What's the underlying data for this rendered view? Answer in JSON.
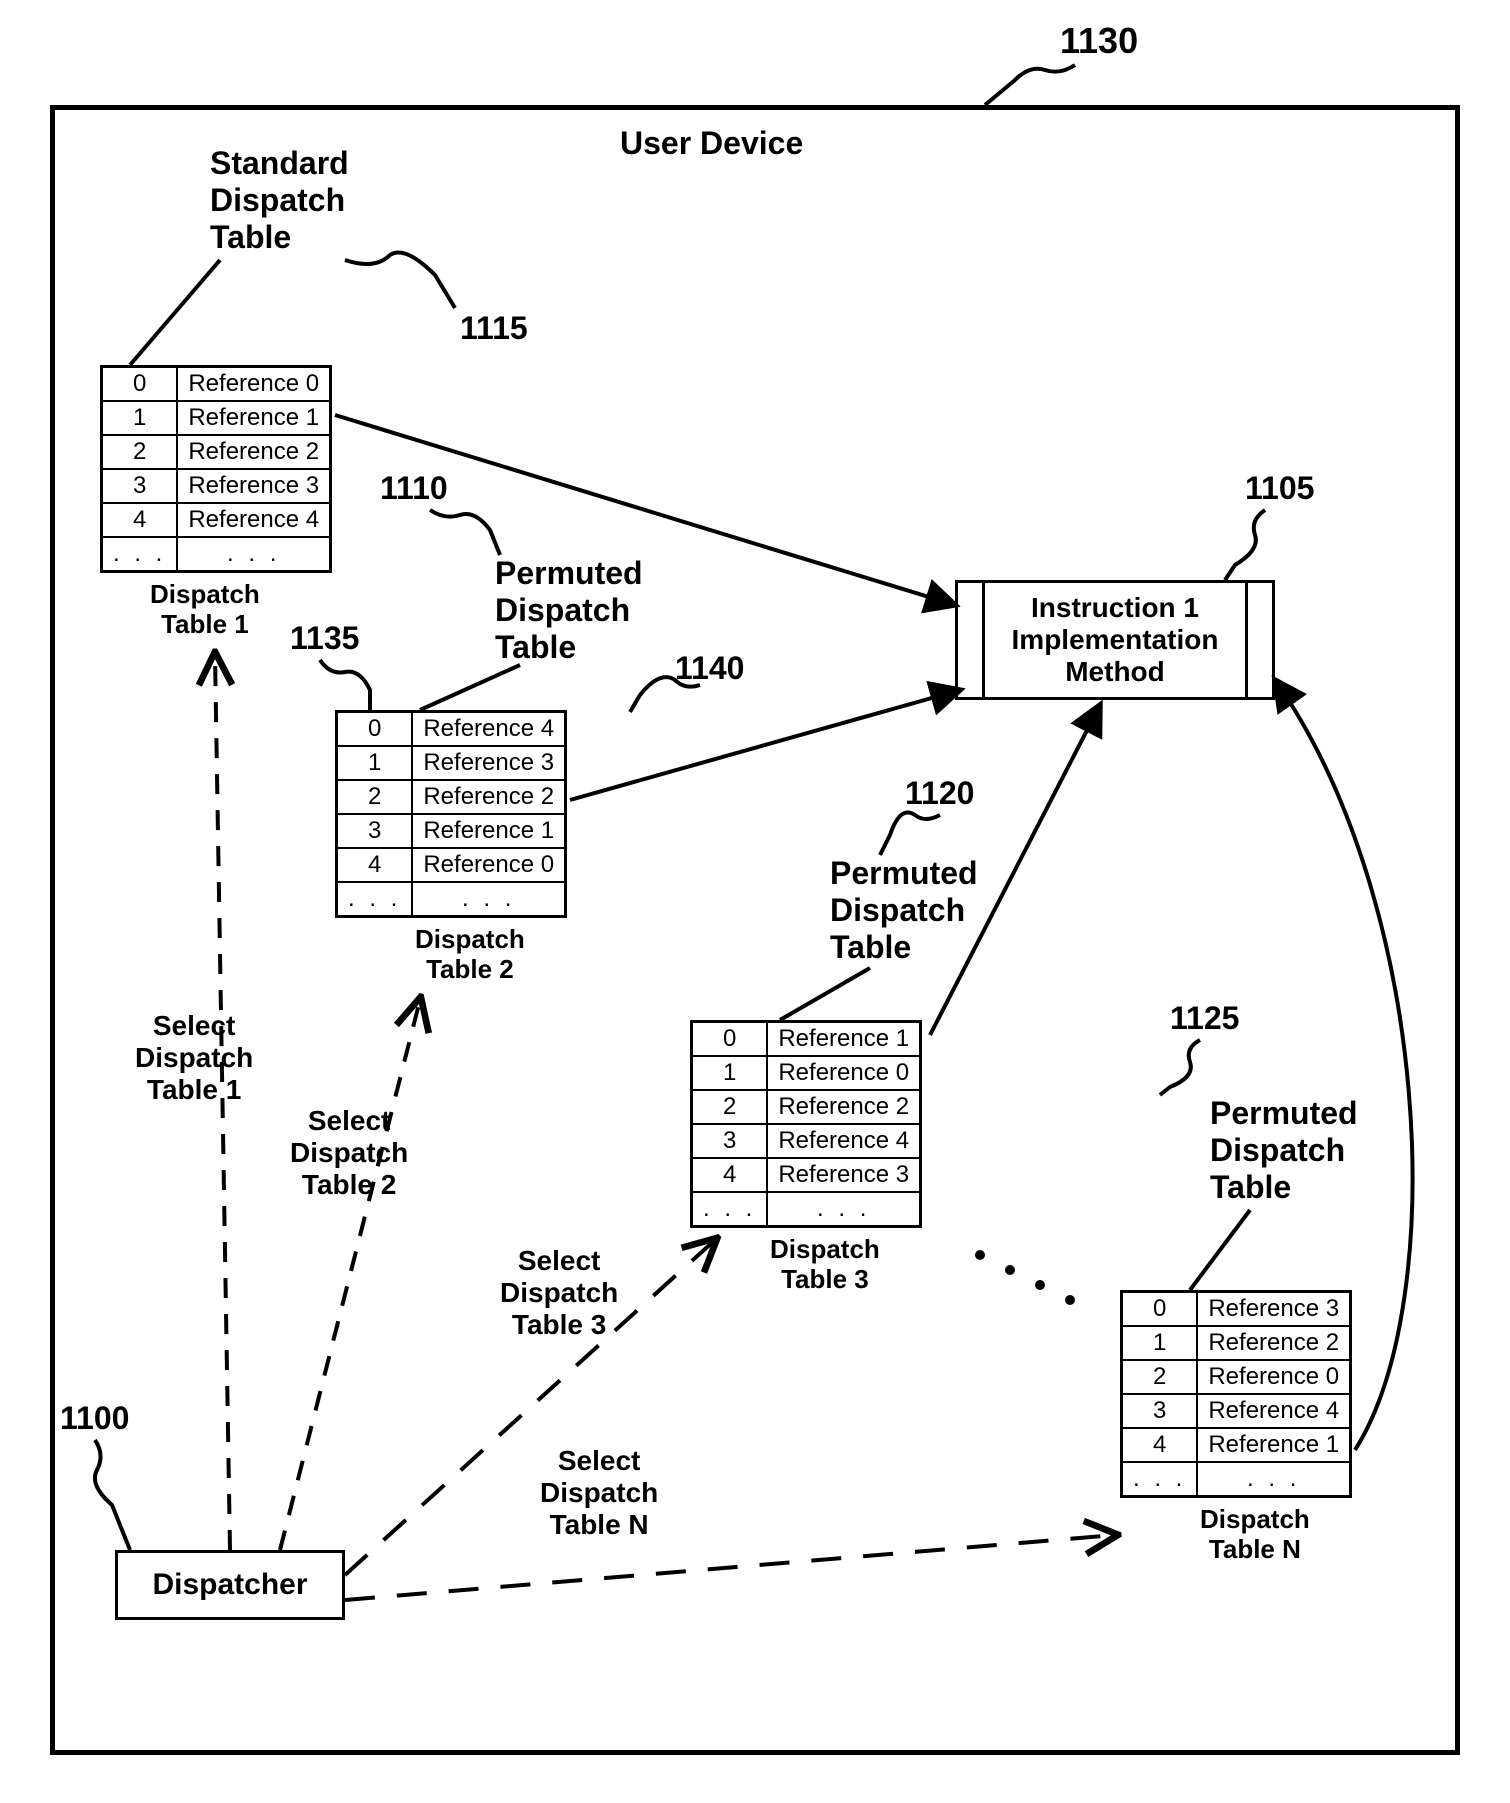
{
  "figure": {
    "ref_1130": "1130",
    "device_title": "User Device",
    "ref_1115": "1115",
    "ref_1105": "1105",
    "ref_1110": "1110",
    "ref_1135": "1135",
    "ref_1140": "1140",
    "ref_1120": "1120",
    "ref_1125": "1125",
    "ref_1100": "1100",
    "standard_label": "Standard\nDispatch\nTable",
    "permuted_label_1": "Permuted\nDispatch\nTable",
    "permuted_label_2": "Permuted\nDispatch\nTable",
    "permuted_label_3": "Permuted\nDispatch\nTable",
    "impl_label": "Instruction 1\nImplementation\nMethod",
    "dispatcher_label": "Dispatcher",
    "select1": "Select\nDispatch\nTable 1",
    "select2": "Select\nDispatch\nTable 2",
    "select3": "Select\nDispatch\nTable 3",
    "selectN": "Select\nDispatch\nTable N",
    "caption1": "Dispatch\nTable 1",
    "caption2": "Dispatch\nTable 2",
    "caption3": "Dispatch\nTable 3",
    "captionN": "Dispatch\nTable N"
  },
  "tables": {
    "t1": [
      [
        "0",
        "Reference 0"
      ],
      [
        "1",
        "Reference 1"
      ],
      [
        "2",
        "Reference 2"
      ],
      [
        "3",
        "Reference 3"
      ],
      [
        "4",
        "Reference 4"
      ],
      [
        ". . .",
        ". . ."
      ]
    ],
    "t2": [
      [
        "0",
        "Reference 4"
      ],
      [
        "1",
        "Reference 3"
      ],
      [
        "2",
        "Reference 2"
      ],
      [
        "3",
        "Reference 1"
      ],
      [
        "4",
        "Reference 0"
      ],
      [
        ". . .",
        ". . ."
      ]
    ],
    "t3": [
      [
        "0",
        "Reference 1"
      ],
      [
        "1",
        "Reference 0"
      ],
      [
        "2",
        "Reference 2"
      ],
      [
        "3",
        "Reference 4"
      ],
      [
        "4",
        "Reference 3"
      ],
      [
        ". . .",
        ". . ."
      ]
    ],
    "tN": [
      [
        "0",
        "Reference 3"
      ],
      [
        "1",
        "Reference 2"
      ],
      [
        "2",
        "Reference 0"
      ],
      [
        "3",
        "Reference 4"
      ],
      [
        "4",
        "Reference 1"
      ],
      [
        ". . .",
        ". . ."
      ]
    ]
  }
}
